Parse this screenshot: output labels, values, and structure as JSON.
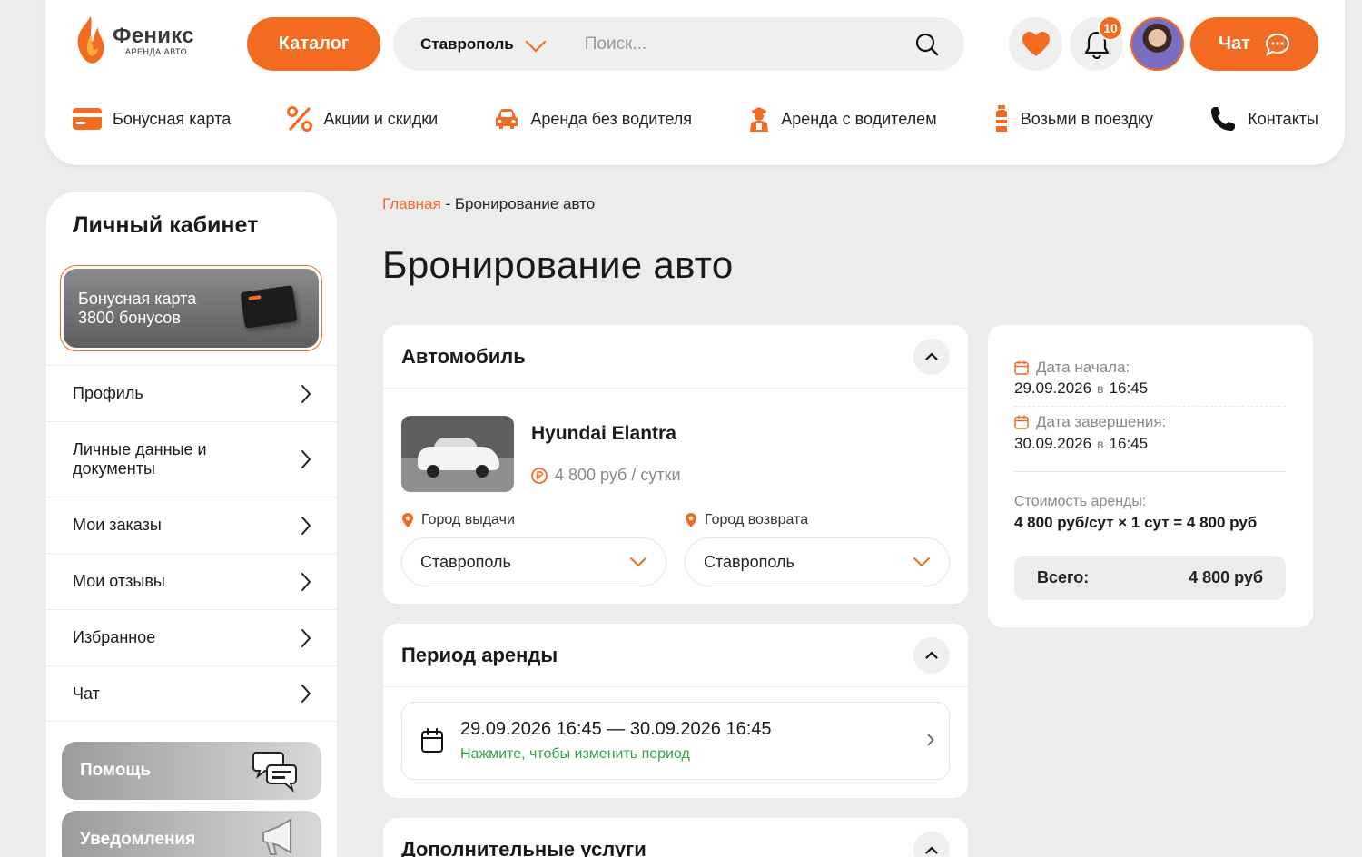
{
  "header": {
    "logo": {
      "name": "Феникс",
      "subtitle": "АРЕНДА АВТО"
    },
    "catalog_label": "Каталог",
    "city": "Ставрополь",
    "search_placeholder": "Поиск...",
    "notifications_count": "10",
    "chat_label": "Чат",
    "accent_color": "#f36b21"
  },
  "nav": {
    "items": [
      {
        "label": "Бонусная карта",
        "icon": "card-icon"
      },
      {
        "label": "Акции и скидки",
        "icon": "percent-icon"
      },
      {
        "label": "Аренда без водителя",
        "icon": "car-icon"
      },
      {
        "label": "Аренда с водителем",
        "icon": "driver-icon"
      },
      {
        "label": "Возьми в поездку",
        "icon": "bottle-icon"
      },
      {
        "label": "Контакты",
        "icon": "phone-icon"
      }
    ]
  },
  "sidebar": {
    "title": "Личный кабинет",
    "bonus_line1": "Бонусная карта",
    "bonus_line2": "3800 бонусов",
    "items": [
      {
        "label": "Профиль"
      },
      {
        "label": "Личные данные и документы"
      },
      {
        "label": "Мои заказы"
      },
      {
        "label": "Мои отзывы"
      },
      {
        "label": "Избранное"
      },
      {
        "label": "Чат"
      }
    ],
    "help_label": "Помощь",
    "notifications_label": "Уведомления"
  },
  "breadcrumb": {
    "home": "Главная",
    "separator": " - ",
    "current": "Бронирование авто"
  },
  "page_title": "Бронирование авто",
  "car_section": {
    "title": "Автомобиль",
    "car_name": "Hyundai Elantra",
    "price": "4 800 руб / сутки",
    "pickup_label": "Город выдачи",
    "pickup_value": "Ставрополь",
    "return_label": "Город возврата",
    "return_value": "Ставрополь"
  },
  "period_section": {
    "title": "Период аренды",
    "period": "29.09.2026 16:45 — 30.09.2026 16:45",
    "hint": "Нажмите, чтобы изменить период",
    "hint_color": "#2fa34a"
  },
  "extra_section": {
    "title": "Дополнительные услуги"
  },
  "summary": {
    "start_label": "Дата начала:",
    "start_date": "29.09.2026",
    "start_time": "16:45",
    "end_label": "Дата завершения:",
    "end_date": "30.09.2026",
    "end_time": "16:45",
    "at_word": "в",
    "cost_label": "Стоимость аренды:",
    "cost_formula": "4 800 руб/сут × 1 сут = 4 800 руб",
    "total_label": "Всего:",
    "total_value": "4 800 руб"
  }
}
